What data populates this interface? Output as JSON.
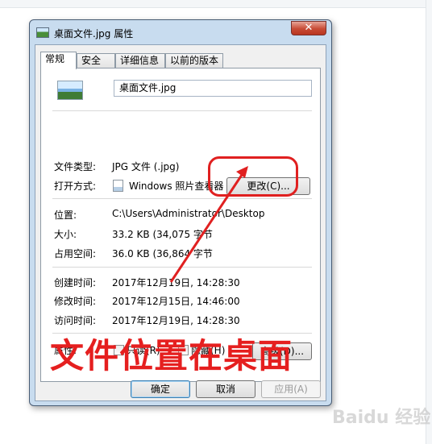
{
  "window": {
    "title": "桌面文件.jpg 属性",
    "close_glyph": "✕"
  },
  "tabs": [
    "常规",
    "安全",
    "详细信息",
    "以前的版本"
  ],
  "general": {
    "file_name": "桌面文件.jpg",
    "type_label": "文件类型:",
    "type_value": "JPG 文件 (.jpg)",
    "open_with_label": "打开方式:",
    "open_with_value": "Windows 照片查看器",
    "change_button": "更改(C)...",
    "location_label": "位置:",
    "location_value": "C:\\Users\\Administrator\\Desktop",
    "size_label": "大小:",
    "size_value": "33.2 KB (34,075 字节",
    "size_on_disk_label": "占用空间:",
    "size_on_disk_value": "36.0 KB (36,864 字节",
    "created_label": "创建时间:",
    "created_value": "2017年12月19日, 14:28:30",
    "modified_label": "修改时间:",
    "modified_value": "2017年12月15日, 14:46:00",
    "accessed_label": "访问时间:",
    "accessed_value": "2017年12月19日, 14:28:30",
    "attributes_label": "属性:",
    "readonly_label": "只读(R)",
    "hidden_label": "隐藏(H)",
    "advanced_button": "高级(D)..."
  },
  "footer": {
    "ok": "确定",
    "cancel": "取消",
    "apply": "应用(A)"
  },
  "annotation": {
    "text": "文件位置在桌面",
    "color": "#e51f1f"
  },
  "watermark": "Baidu 经验"
}
